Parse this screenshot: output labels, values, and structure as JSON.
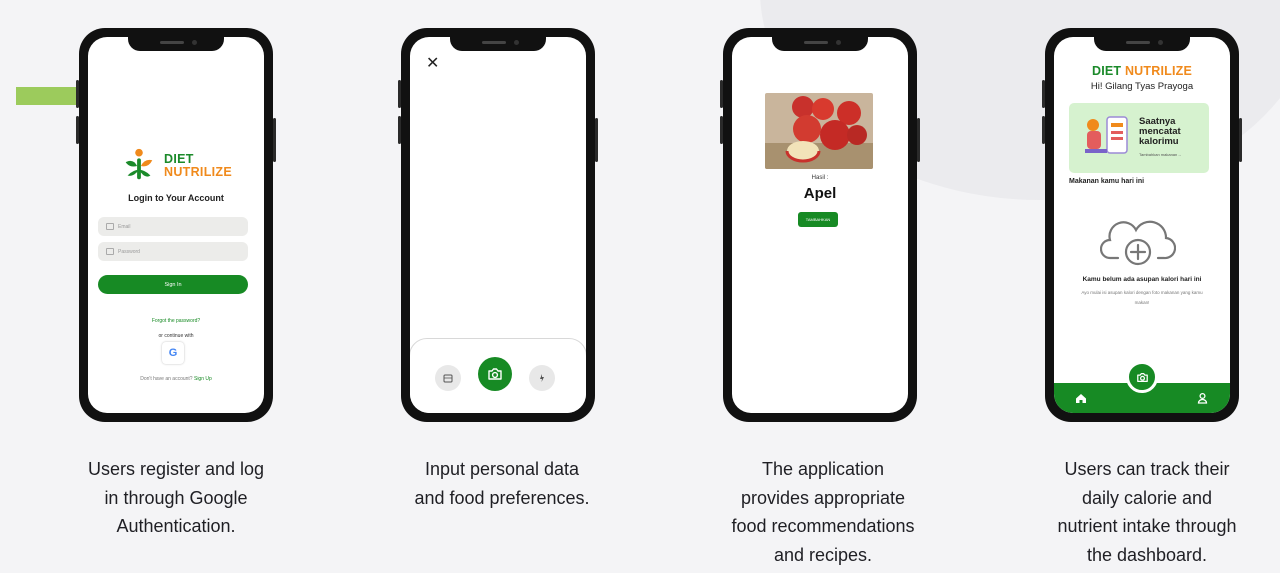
{
  "colors": {
    "brand_green": "#178a24",
    "brand_orange": "#f08a1c",
    "accent_bar": "#9ccb5c"
  },
  "screens": {
    "login": {
      "brand_line1": "DIET",
      "brand_line2": "NUTRILIZE",
      "title": "Login to Your Account",
      "email_placeholder": "Email",
      "password_placeholder": "Password",
      "sign_in_label": "Sign In",
      "forgot_label": "Forgot the password?",
      "or_continue": "or continue with",
      "google_icon_letter": "G",
      "signup_prompt": "Don't have an account?",
      "signup_link": "Sign Up"
    },
    "camera": {
      "close_icon": "✕"
    },
    "result": {
      "label": "Hasil :",
      "value": "Apel",
      "add_button": "TAMBAHKAN"
    },
    "dashboard": {
      "brand_part1": "DIET",
      "brand_part2": "NUTRILIZE",
      "greeting": "Hi! Gilang Tyas Prayoga",
      "promo_title": "Saatnya mencatat kalorimu",
      "promo_link": "Tambahkan makanan→",
      "section_label": "Makanan kamu hari ini",
      "empty_title": "Kamu belum ada asupan kalori hari ini",
      "empty_subtitle": "Ayo mulai isi asupan kalori dengan foto makanan yang kamu makan!"
    }
  },
  "captions": [
    "Users register and log\nin through Google\nAuthentication.",
    "Input personal data\nand food preferences.",
    "The application\nprovides appropriate\nfood recommendations\nand recipes.",
    "Users can track their\ndaily calorie and\nnutrient intake through\nthe dashboard."
  ]
}
